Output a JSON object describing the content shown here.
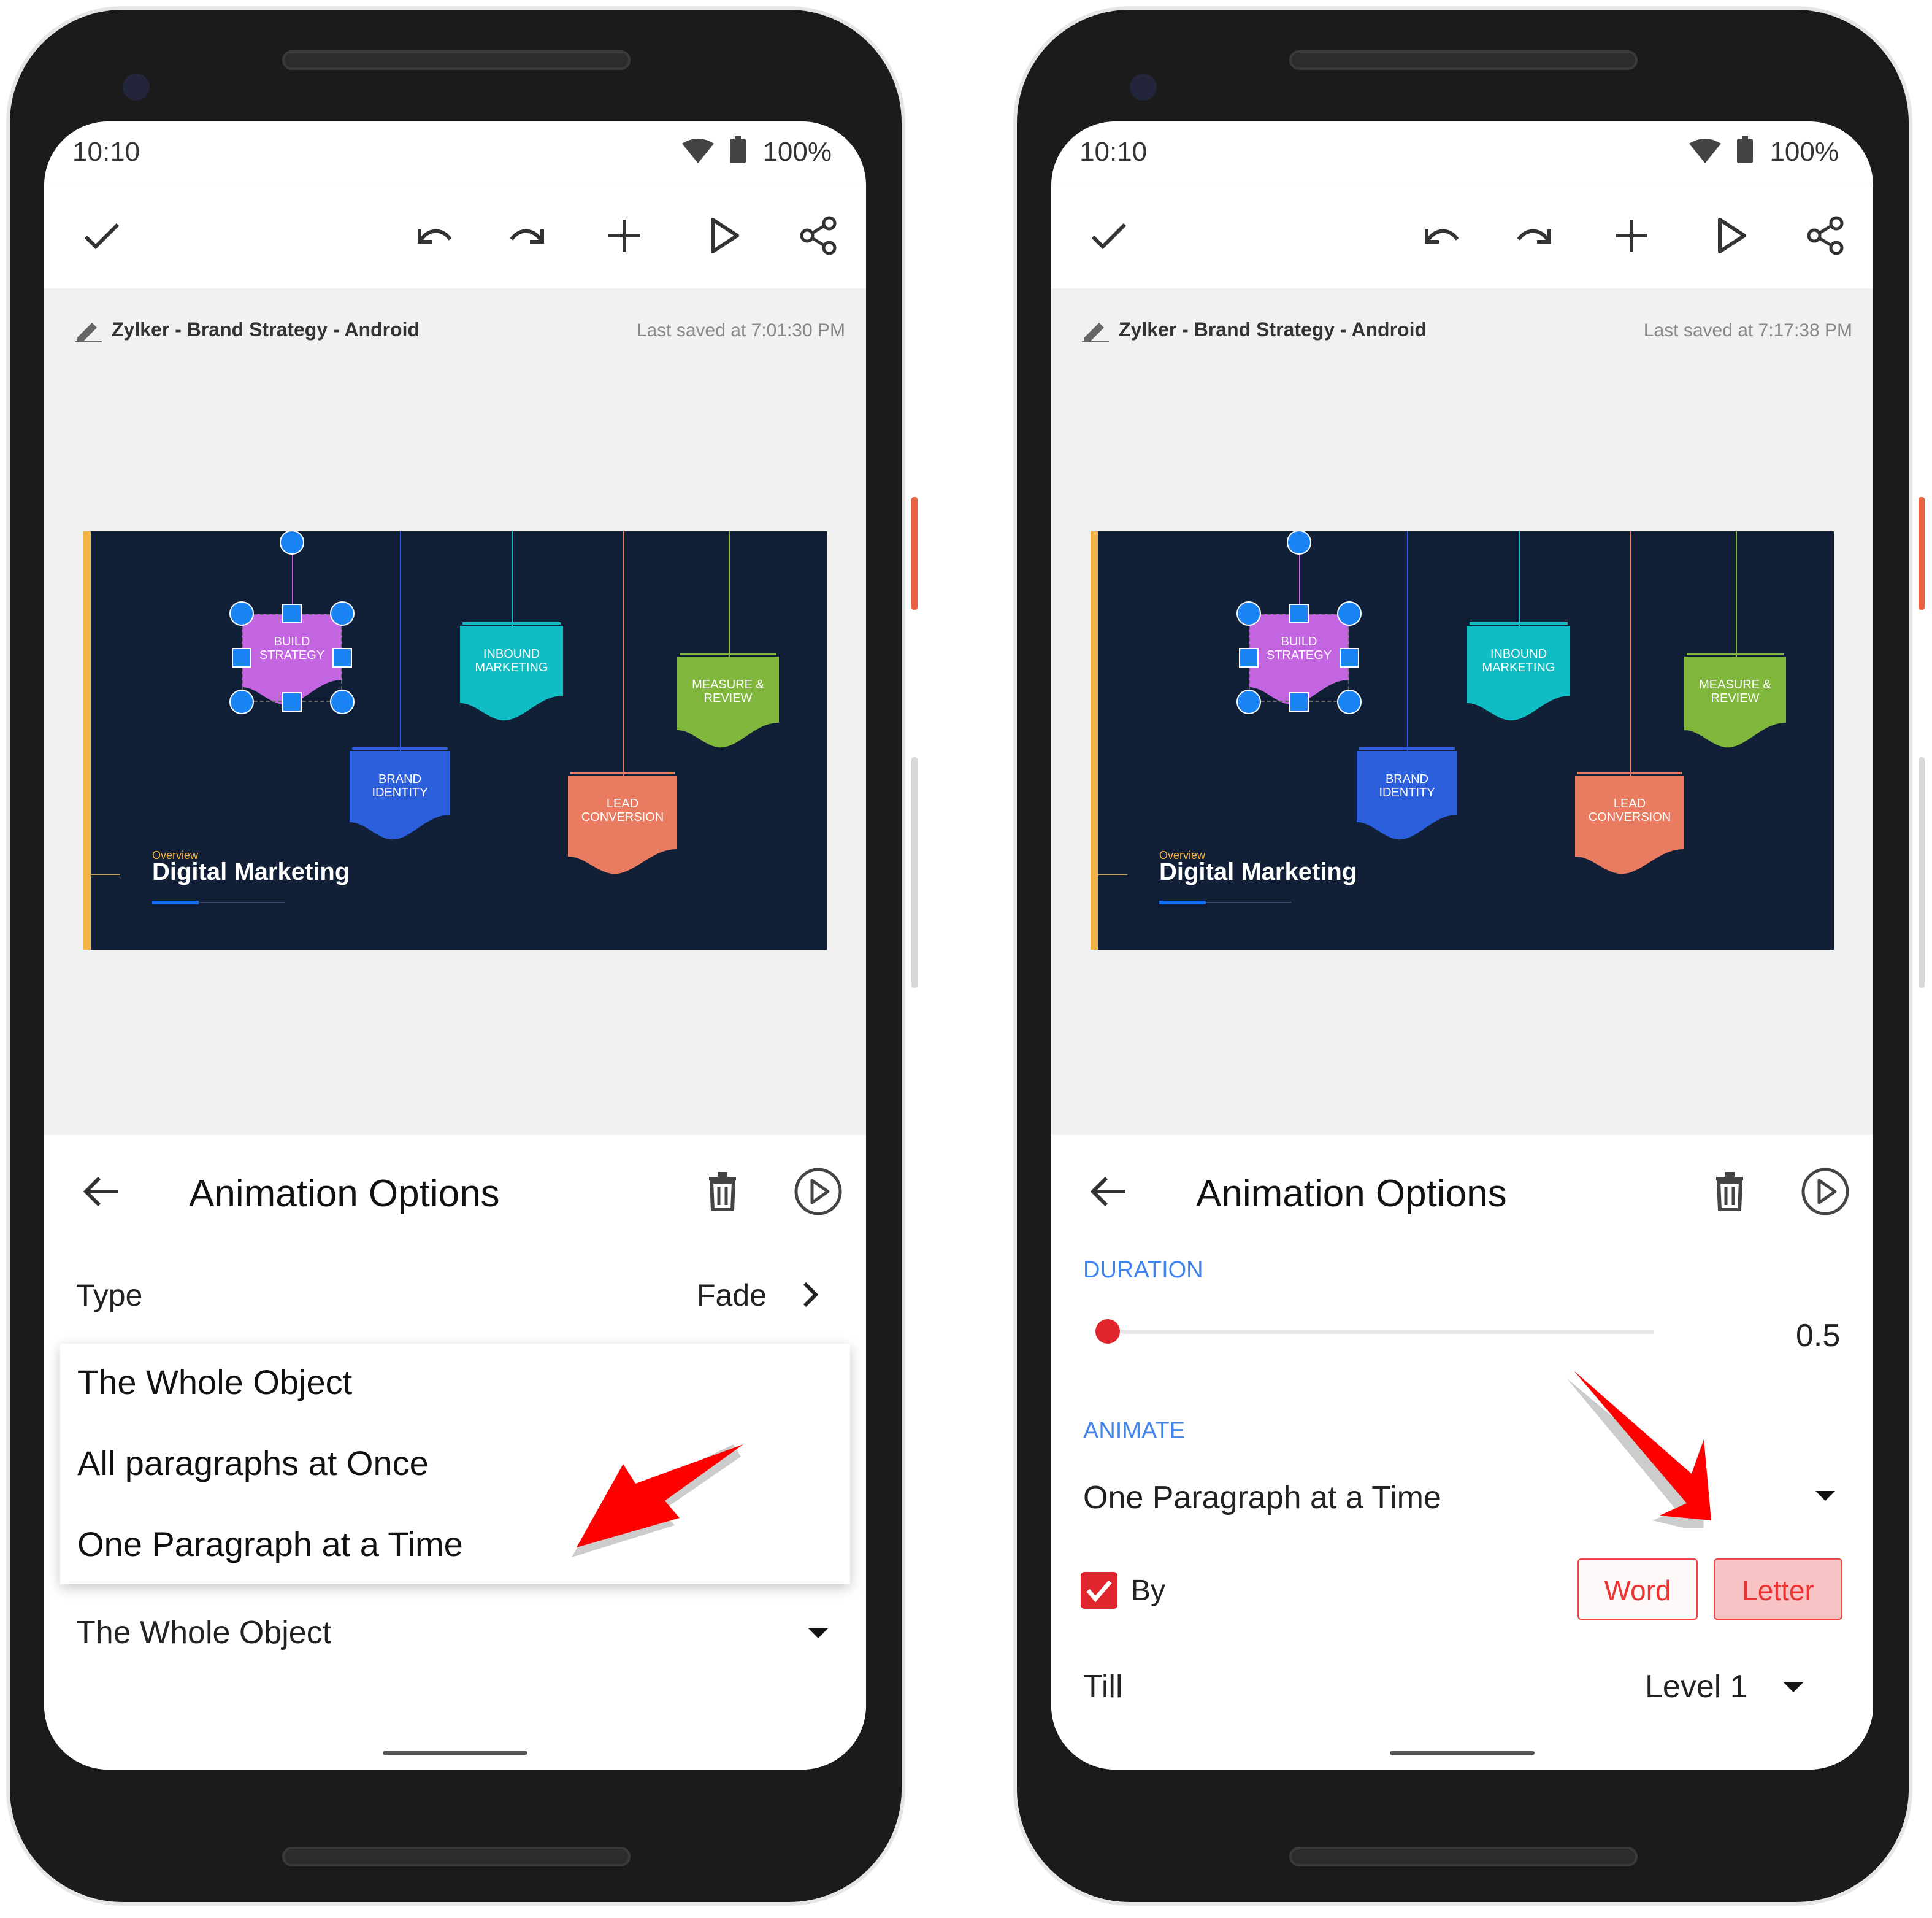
{
  "colors": {
    "accent_blue": "#3f83ee",
    "accent_red": "#e0262c",
    "slide_bg": "#112036",
    "arrow": "#ff0000"
  },
  "phones": [
    {
      "time": "10:10",
      "battery": "100%",
      "doc_title": "Zylker - Brand Strategy - Android",
      "last_saved": "Last saved at 7:01:30 PM"
    },
    {
      "time": "10:10",
      "battery": "100%",
      "doc_title": "Zylker - Brand Strategy - Android",
      "last_saved": "Last saved at 7:17:38 PM"
    }
  ],
  "toolbar_icons": [
    "check-icon",
    "undo-icon",
    "redo-icon",
    "plus-icon",
    "play-icon",
    "share-icon"
  ],
  "slide": {
    "banners": [
      {
        "label": "BUILD STRATEGY",
        "color": "#c364e0"
      },
      {
        "label": "INBOUND MARKETING",
        "color": "#10bdc4"
      },
      {
        "label": "BRAND IDENTITY",
        "color": "#2c5fdc"
      },
      {
        "label": "LEAD CONVERSION",
        "color": "#e87b60"
      },
      {
        "label": "MEASURE & REVIEW",
        "color": "#80b73c"
      }
    ],
    "overview": "Overview",
    "title": "Digital Marketing"
  },
  "panel_left": {
    "title": "Animation Options",
    "type_label": "Type",
    "type_value": "Fade",
    "menu_items": [
      "The Whole Object",
      "All paragraphs at Once",
      "One Paragraph at a Time"
    ],
    "selected": "The Whole Object"
  },
  "panel_right": {
    "title": "Animation Options",
    "duration_label": "DURATION",
    "duration_value": "0.5",
    "duration_fraction": 0,
    "animate_label": "ANIMATE",
    "animate_value": "One Paragraph at a Time",
    "by_label": "By",
    "by_checked": true,
    "word_label": "Word",
    "letter_label": "Letter",
    "letter_selected": true,
    "till_label": "Till",
    "till_value": "Level 1"
  }
}
